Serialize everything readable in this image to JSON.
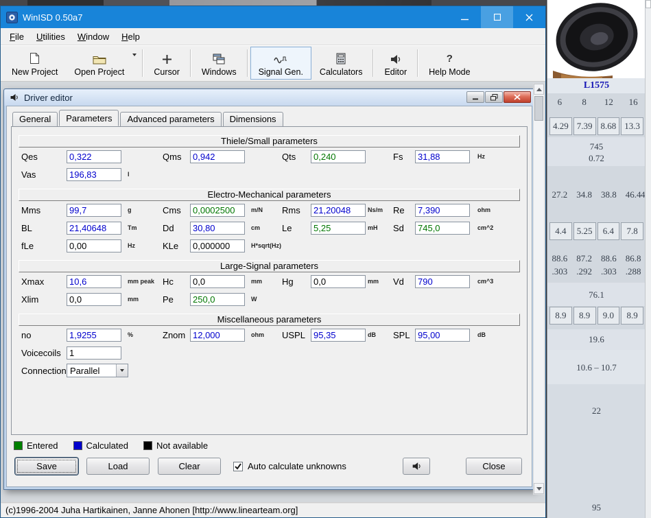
{
  "colors": {
    "titlebar_blue": "#1884d9",
    "entered": "#007600",
    "calculated": "#0000cd",
    "not_available": "#000000"
  },
  "icons": {
    "help_glyph": "?"
  },
  "app": {
    "title": "WinISD 0.50a7",
    "menu": [
      {
        "label": "File"
      },
      {
        "label": "Utilities"
      },
      {
        "label": "Window"
      },
      {
        "label": "Help"
      }
    ],
    "toolbar": [
      {
        "label": "New Project"
      },
      {
        "label": "Open Project"
      },
      {
        "label": "Cursor"
      },
      {
        "label": "Windows"
      },
      {
        "label": "Signal Gen."
      },
      {
        "label": "Calculators"
      },
      {
        "label": "Editor"
      },
      {
        "label": "Help Mode"
      }
    ],
    "statusbar_text": "(c)1996-2004 Juha Hartikainen, Janne Ahonen [http://www.linearteam.org]"
  },
  "dialog": {
    "title": "Driver editor",
    "tabs": [
      {
        "label": "General"
      },
      {
        "label": "Parameters"
      },
      {
        "label": "Advanced parameters"
      },
      {
        "label": "Dimensions"
      }
    ],
    "sections": {
      "thiele_title": "Thiele/Small parameters",
      "electro_title": "Electro-Mechanical parameters",
      "large_title": "Large-Signal parameters",
      "misc_title": "Miscellaneous parameters"
    },
    "fields": {
      "qes": {
        "label": "Qes",
        "value": "0,322",
        "unit": "",
        "state": "calculated"
      },
      "qms": {
        "label": "Qms",
        "value": "0,942",
        "unit": "",
        "state": "calculated"
      },
      "qts": {
        "label": "Qts",
        "value": "0,240",
        "unit": "",
        "state": "entered"
      },
      "fs": {
        "label": "Fs",
        "value": "31,88",
        "unit": "Hz",
        "state": "calculated"
      },
      "vas": {
        "label": "Vas",
        "value": "196,83",
        "unit": "l",
        "state": "calculated"
      },
      "mms": {
        "label": "Mms",
        "value": "99,7",
        "unit": "g",
        "state": "calculated"
      },
      "cms": {
        "label": "Cms",
        "value": "0,0002500",
        "unit": "m/N",
        "state": "entered"
      },
      "rms": {
        "label": "Rms",
        "value": "21,20048",
        "unit": "Ns/m",
        "state": "calculated"
      },
      "re": {
        "label": "Re",
        "value": "7,390",
        "unit": "ohm",
        "state": "calculated"
      },
      "bl": {
        "label": "BL",
        "value": "21,40648",
        "unit": "Tm",
        "state": "calculated"
      },
      "dd": {
        "label": "Dd",
        "value": "30,80",
        "unit": "cm",
        "state": "calculated"
      },
      "le": {
        "label": "Le",
        "value": "5,25",
        "unit": "mH",
        "state": "entered"
      },
      "sd": {
        "label": "Sd",
        "value": "745,0",
        "unit": "cm^2",
        "state": "entered"
      },
      "fle": {
        "label": "fLe",
        "value": "0,00",
        "unit": "Hz",
        "state": "not_available"
      },
      "kle": {
        "label": "KLe",
        "value": "0,000000",
        "unit": "H*sqrt(Hz)",
        "state": "not_available"
      },
      "xmax": {
        "label": "Xmax",
        "value": "10,6",
        "unit": "mm peak",
        "state": "calculated"
      },
      "hc": {
        "label": "Hc",
        "value": "0,0",
        "unit": "mm",
        "state": "not_available"
      },
      "hg": {
        "label": "Hg",
        "value": "0,0",
        "unit": "mm",
        "state": "not_available"
      },
      "vd": {
        "label": "Vd",
        "value": "790",
        "unit": "cm^3",
        "state": "calculated"
      },
      "xlim": {
        "label": "Xlim",
        "value": "0,0",
        "unit": "mm",
        "state": "not_available"
      },
      "pe": {
        "label": "Pe",
        "value": "250,0",
        "unit": "W",
        "state": "entered"
      },
      "no": {
        "label": "no",
        "value": "1,9255",
        "unit": "%",
        "state": "calculated"
      },
      "znom": {
        "label": "Znom",
        "value": "12,000",
        "unit": "ohm",
        "state": "calculated"
      },
      "uspl": {
        "label": "USPL",
        "value": "95,35",
        "unit": "dB",
        "state": "calculated"
      },
      "spl": {
        "label": "SPL",
        "value": "95,00",
        "unit": "dB",
        "state": "calculated"
      },
      "voicecoils": {
        "label": "Voicecoils",
        "value": "1",
        "unit": "",
        "state": "plain"
      },
      "connection": {
        "label": "Connection",
        "value": "Parallel",
        "unit": "",
        "state": "plain"
      }
    },
    "legend": {
      "entered": {
        "label": "Entered",
        "color": "#008000"
      },
      "calculated": {
        "label": "Calculated",
        "color": "#0000cc"
      },
      "not_available": {
        "label": "Not available",
        "color": "#000000"
      }
    },
    "autocalc_label": "Auto calculate unknowns",
    "buttons": {
      "save": "Save",
      "load": "Load",
      "clear": "Clear",
      "close": "Close"
    }
  },
  "side_panel": {
    "model": "L1575",
    "rows": [
      {
        "style": "plain",
        "values": [
          "6",
          "8",
          "12",
          "16"
        ]
      },
      {
        "style": "cells",
        "values": [
          "4.29",
          "7.39",
          "8.68",
          "13.3"
        ]
      },
      {
        "style": "single",
        "values": [
          "745"
        ]
      },
      {
        "style": "single",
        "values": [
          "0.72"
        ]
      },
      {
        "style": "plain",
        "values": [
          "27.2",
          "34.8",
          "38.8",
          "46.4",
          "4"
        ]
      },
      {
        "style": "cells",
        "values": [
          "4.4",
          "5.25",
          "6.4",
          "7.8"
        ]
      },
      {
        "style": "plain",
        "values": [
          "88.6",
          "87.2",
          "88.6",
          "86.8"
        ]
      },
      {
        "style": "plain",
        "values": [
          ".303",
          ".292",
          ".303",
          ".288"
        ]
      },
      {
        "style": "single",
        "values": [
          "76.1"
        ]
      },
      {
        "style": "cells",
        "values": [
          "8.9",
          "8.9",
          "9.0",
          "8.9"
        ]
      },
      {
        "style": "single",
        "values": [
          "19.6"
        ]
      },
      {
        "style": "single",
        "values": [
          "10.6 – 10.7"
        ]
      },
      {
        "style": "single",
        "values": [
          "22"
        ]
      },
      {
        "style": "single",
        "values": [
          "95"
        ]
      }
    ]
  }
}
